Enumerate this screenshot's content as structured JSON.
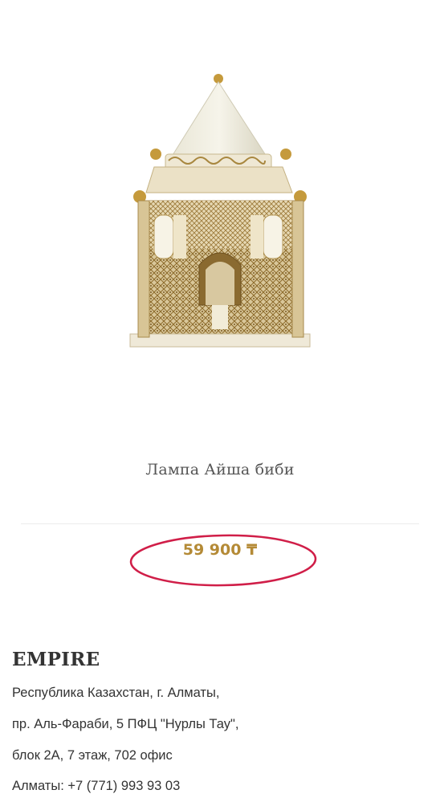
{
  "product": {
    "image_icon": "lamp-image",
    "title": "Лампа Айша биби",
    "price": "59 900 ₸",
    "highlight_color": "#d01e48",
    "price_color": "#b48a36"
  },
  "store": {
    "name": "EMPIRE",
    "address_lines": [
      "Республика Казахстан, г. Алматы,",
      "пр. Аль-Фараби, 5 ПФЦ \"Нурлы Тау\",",
      "блок 2А, 7 этаж, 702 офис",
      "Алматы: +7 (771) 993 93 03"
    ]
  }
}
